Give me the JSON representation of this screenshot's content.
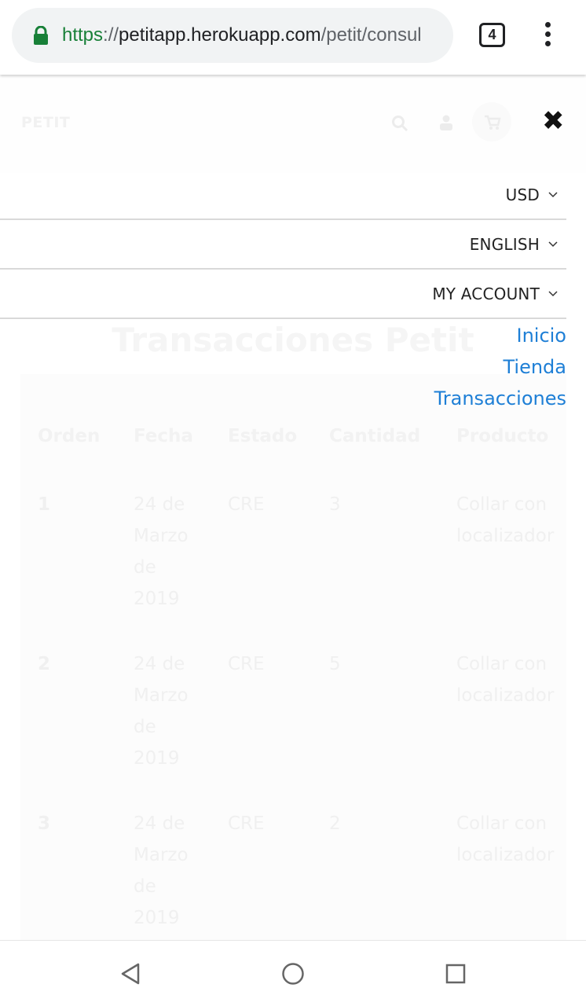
{
  "browser": {
    "url_scheme": "https",
    "url_sep": "://",
    "url_host": "petitapp.herokuapp.com",
    "url_path": "/petit/consul",
    "tab_count": "4",
    "lock_icon": "lock-icon",
    "menu_icon": "more-vert-icon"
  },
  "site_header": {
    "logo": "PETIT",
    "search_icon": "search-icon",
    "user_icon": "user-icon",
    "cart_icon": "cart-icon",
    "close_symbol": "✖"
  },
  "menu": {
    "currency": "USD",
    "language": "ENGLISH",
    "account": "MY ACCOUNT",
    "links": [
      "Inicio",
      "Tienda",
      "Transacciones"
    ]
  },
  "page": {
    "title": "Transacciones Petit",
    "table": {
      "headers": [
        "Orden",
        "Fecha",
        "Estado",
        "Cantidad",
        "Producto"
      ],
      "rows": [
        {
          "orden": "1",
          "fecha": [
            "24 de",
            "Marzo",
            "de",
            "2019"
          ],
          "estado": "CRE",
          "cantidad": "3",
          "producto": [
            "Collar con",
            "localizador"
          ]
        },
        {
          "orden": "2",
          "fecha": [
            "24 de",
            "Marzo",
            "de",
            "2019"
          ],
          "estado": "CRE",
          "cantidad": "5",
          "producto": [
            "Collar con",
            "localizador"
          ]
        },
        {
          "orden": "3",
          "fecha": [
            "24 de",
            "Marzo",
            "de",
            "2019"
          ],
          "estado": "CRE",
          "cantidad": "2",
          "producto": [
            "Collar con",
            "localizador"
          ]
        }
      ]
    }
  },
  "system_nav": {
    "back_icon": "back-triangle-icon",
    "home_icon": "home-circle-icon",
    "recents_icon": "recents-square-icon"
  },
  "colors": {
    "link": "#1e7fd6",
    "url_scheme": "#188038",
    "divider": "#d9d9d9"
  }
}
